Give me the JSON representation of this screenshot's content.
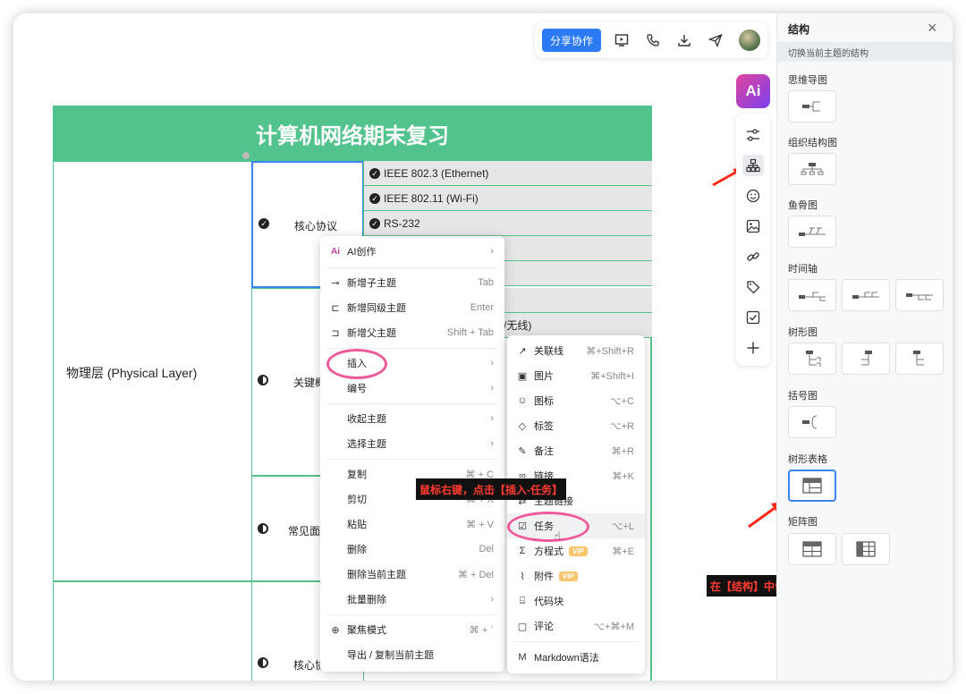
{
  "toolbar": {
    "share_label": "分享协作",
    "icons": [
      "present-icon",
      "phone-icon",
      "download-icon",
      "send-icon"
    ]
  },
  "map": {
    "title": "计算机网络期末复习",
    "root_label": "物理层 (Physical Layer)",
    "branches": [
      {
        "label": "核心协议",
        "status": "done"
      },
      {
        "label": "关键概",
        "status": "half"
      },
      {
        "label": "常见面",
        "status": "half"
      },
      {
        "label": "核心协",
        "status": "half"
      }
    ],
    "leaves": [
      "IEEE 802.3 (Ethernet)",
      "IEEE 802.11 (Wi-Fi)",
      "RS-232"
    ],
    "partial_text": "/无线)"
  },
  "context_menu": {
    "items": [
      {
        "label": "AI创作",
        "shortcut": "",
        "submenu": true
      },
      {
        "label": "新增子主题",
        "shortcut": "Tab"
      },
      {
        "label": "新增同级主题",
        "shortcut": "Enter"
      },
      {
        "label": "新增父主题",
        "shortcut": "Shift + Tab"
      },
      {
        "label": "插入",
        "shortcut": "",
        "submenu": true
      },
      {
        "label": "编号",
        "shortcut": "",
        "submenu": true
      },
      {
        "label": "收起主题",
        "shortcut": "",
        "submenu": true
      },
      {
        "label": "选择主题",
        "shortcut": "",
        "submenu": true
      },
      {
        "label": "复制",
        "shortcut": "⌘ + C"
      },
      {
        "label": "剪切",
        "shortcut": "⌘ + X"
      },
      {
        "label": "粘贴",
        "shortcut": "⌘ + V"
      },
      {
        "label": "删除",
        "shortcut": "Del"
      },
      {
        "label": "删除当前主题",
        "shortcut": "⌘ + Del"
      },
      {
        "label": "批量删除",
        "shortcut": "",
        "submenu": true
      },
      {
        "label": "聚焦模式",
        "shortcut": "⌘ + `"
      },
      {
        "label": "导出 / 复制当前主题",
        "shortcut": ""
      }
    ]
  },
  "insert_submenu": {
    "items": [
      {
        "label": "关联线",
        "shortcut": "⌘+Shift+R"
      },
      {
        "label": "图片",
        "shortcut": "⌘+Shift+I"
      },
      {
        "label": "图标",
        "shortcut": "⌥+C"
      },
      {
        "label": "标签",
        "shortcut": "⌥+R"
      },
      {
        "label": "备注",
        "shortcut": "⌘+R"
      },
      {
        "label": "链接",
        "shortcut": "⌘+K"
      },
      {
        "label": "主题链接",
        "shortcut": ""
      },
      {
        "label": "任务",
        "shortcut": "⌥+L"
      },
      {
        "label": "方程式",
        "shortcut": "⌘+E",
        "vip": "VIP"
      },
      {
        "label": "附件",
        "shortcut": "",
        "vip": "VIP"
      },
      {
        "label": "代码块",
        "shortcut": ""
      },
      {
        "label": "评论",
        "shortcut": "⌥+⌘+M"
      },
      {
        "label": "Markdown语法",
        "shortcut": ""
      }
    ]
  },
  "annotations": {
    "right_click_tip": "鼠标右键，点击【插入-任务】",
    "structure_tip": "在【结构】中切换为树形表格或矩阵图"
  },
  "side_tools": {
    "ai_label": "Ai"
  },
  "panel": {
    "title": "结构",
    "close_glyph": "×",
    "subtitle": "切换当前主题的结构",
    "sections": [
      "思维导图",
      "组织结构图",
      "鱼骨图",
      "时间轴",
      "树形图",
      "括号图",
      "树形表格",
      "矩阵图"
    ]
  },
  "colors": {
    "accent": "#2d7bf4",
    "map_green": "#52c38c",
    "highlight_pink": "#ef5a9b",
    "annotation_red": "#ff3b30"
  }
}
